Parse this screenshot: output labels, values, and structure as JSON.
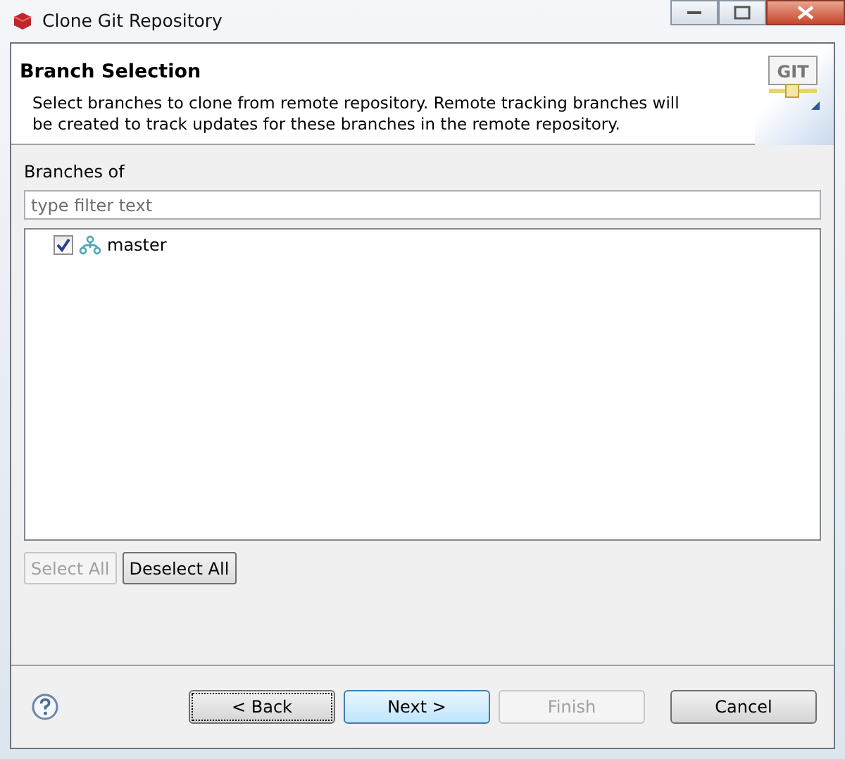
{
  "window": {
    "title": "Clone Git Repository"
  },
  "header": {
    "title": "Branch Selection",
    "description": "Select branches to clone from remote repository. Remote tracking branches will be created to track updates for these branches in the remote repository.",
    "logo_text": "GIT"
  },
  "branches": {
    "label": "Branches of",
    "filter": {
      "placeholder": "type filter text"
    },
    "items": [
      {
        "name": "master",
        "checked": true
      }
    ],
    "buttons": [
      {
        "label": "Select All",
        "disabled": true
      },
      {
        "label": "Deselect All",
        "disabled": false
      }
    ]
  },
  "footer": {
    "buttons": [
      {
        "label": "< Back",
        "disabled": false,
        "focused": true,
        "default": false
      },
      {
        "label": "Next >",
        "disabled": false,
        "focused": false,
        "default": true
      },
      {
        "label": "Finish",
        "disabled": true,
        "focused": false,
        "default": false
      },
      {
        "label": "Cancel",
        "disabled": false,
        "focused": false,
        "default": false
      }
    ]
  }
}
